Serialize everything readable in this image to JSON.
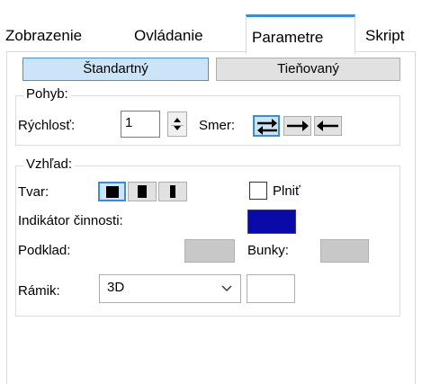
{
  "tabs": [
    {
      "label": "Zobrazenie"
    },
    {
      "label": "Ovládanie"
    },
    {
      "label": "Parametre"
    },
    {
      "label": "Skript"
    }
  ],
  "mode": {
    "standard": "Štandartný",
    "shaded": "Tieňovaný"
  },
  "movement": {
    "title": "Pohyb:",
    "speed_label": "Rýchlosť:",
    "speed_value": "1",
    "direction_label": "Smer:",
    "direction_options": [
      "both-arrows-icon",
      "right-arrow-icon",
      "left-arrow-icon"
    ]
  },
  "appearance": {
    "title": "Vzhľad:",
    "shape_label": "Tvar:",
    "fill_label": "Plniť",
    "fill_checked": false,
    "activity_label": "Indikátor činnosti:",
    "activity_color": "#0a0aa8",
    "background_label": "Podklad:",
    "background_color": "#c8c8c8",
    "cells_label": "Bunky:",
    "cells_color": "#c8c8c8",
    "frame_label": "Rámik:",
    "frame_value": "3D"
  },
  "colors": {
    "accent": "#3c8bd9",
    "selected_bg": "#cce4f7"
  }
}
